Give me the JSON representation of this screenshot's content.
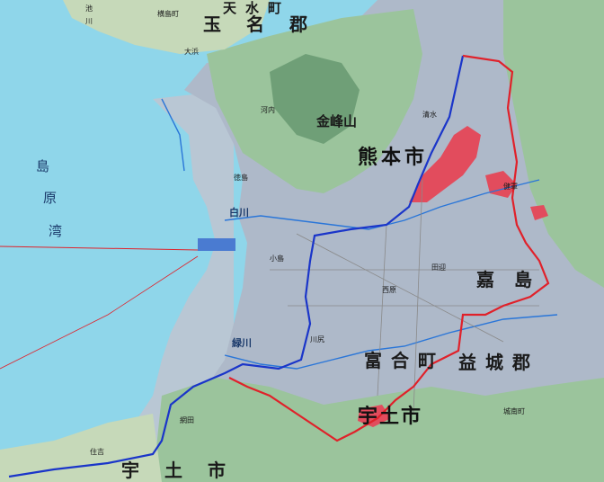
{
  "map": {
    "colors": {
      "sea": "#8fd6ea",
      "tidal_flat": "#b9c7d4",
      "lowland": "#aeb9c9",
      "hills": "#9bc49c",
      "hills_light": "#c6d9b9",
      "mountain_dark": "#6f9f77",
      "urban": "#e24c5d",
      "route_blue": "#1a35c9",
      "route_red": "#e0212a",
      "water_line": "#2a76d8",
      "road": "#8a8a8a"
    },
    "labels": {
      "bay": [
        "島",
        "原",
        "湾"
      ],
      "kumamoto_city": [
        "熊",
        "本",
        "市"
      ],
      "uto_city": [
        "宇",
        "土",
        "市"
      ],
      "uto_city_south": [
        "宇",
        "土",
        "市"
      ],
      "tamana_gun": [
        "玉",
        "名",
        "郡"
      ],
      "tensui_town": [
        "天",
        "水",
        "町"
      ],
      "yokoshima_town": "横島町",
      "kashima_town": [
        "嘉",
        "島"
      ],
      "mashiki_town": [
        "益",
        "城",
        "郡"
      ],
      "tomiai_town": [
        "富",
        "合",
        "町"
      ],
      "shirokawa": "白川",
      "midorikawa": "緑川",
      "kinpozan": "金峰山",
      "ike": "池",
      "kawa": "川",
      "tokushima": "徳島",
      "nagasu": "大浜",
      "kawachi": "河内",
      "shimizu": "清水",
      "kengun": "健軍",
      "tagawa": "田迎",
      "nishihara": "西原",
      "ojima": "小島",
      "kawashiri": "川尻",
      "hiroki": "城南町",
      "sumiyoshi": "住吉",
      "oshima": "網田"
    }
  }
}
